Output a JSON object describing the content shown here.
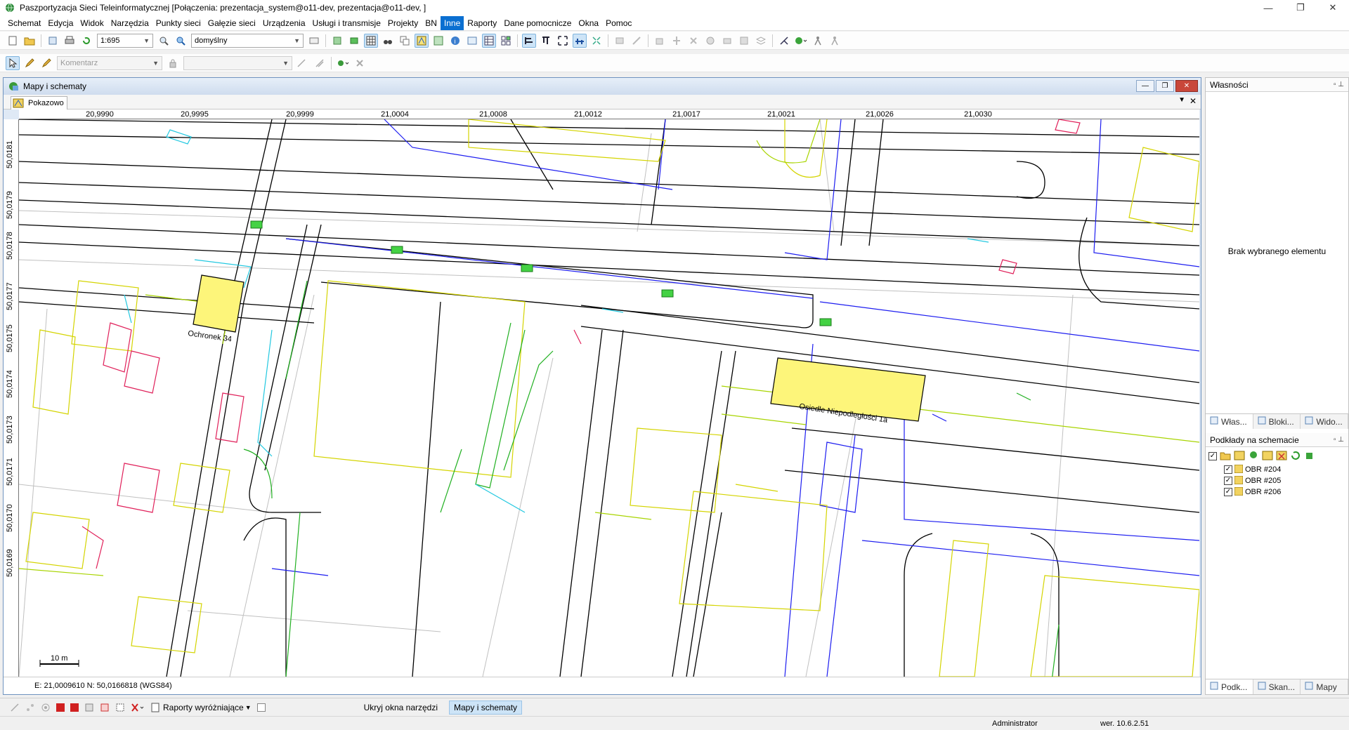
{
  "window": {
    "title": "Paszportyzacja Sieci Teleinformatycznej [Połączenia: prezentacja_system@o11-dev, prezentacja@o11-dev, ]",
    "minimize": "—",
    "restore": "❐",
    "close": "✕"
  },
  "menu": {
    "items": [
      "Schemat",
      "Edycja",
      "Widok",
      "Narzędzia",
      "Punkty sieci",
      "Gałęzie sieci",
      "Urządzenia",
      "Usługi i transmisje",
      "Projekty",
      "BN",
      "Inne",
      "Raporty",
      "Dane pomocnicze",
      "Okna",
      "Pomoc"
    ],
    "active_index": 10
  },
  "toolbar1": {
    "scale_value": "1:695",
    "style_value": "domyślny"
  },
  "toolbar2": {
    "comment_placeholder": "Komentarz"
  },
  "mdi": {
    "title": "Mapy i schematy",
    "tab_label": "Pokazowo"
  },
  "ruler": {
    "x_labels": [
      "20,9990",
      "20,9995",
      "20,9999",
      "21,0004",
      "21,0008",
      "21,0012",
      "21,0017",
      "21,0021",
      "21,0026",
      "21,0030"
    ],
    "y_labels": [
      "50,0181",
      "50,0179",
      "50,0178",
      "50,0177",
      "50,0175",
      "50,0174",
      "50,0173",
      "50,0171",
      "50,0170",
      "50,0169"
    ]
  },
  "map": {
    "street_label_1": "Ochronek 34",
    "street_label_2": "Osiedle Niepodległości 1a",
    "scale_bar_label": "10 m",
    "colors": {
      "building_fill": "#fdf57a",
      "line_black": "#000000",
      "line_blue": "#1d1df0",
      "line_yellow": "#d8d800",
      "line_green": "#20c020",
      "line_cyan": "#23c8e0",
      "line_pink": "#e0205a",
      "line_olive": "#a0d000",
      "node_green": "#44d244"
    }
  },
  "coords": "E: 21,0009610  N: 50,0166818 (WGS84)",
  "properties_panel": {
    "title": "Własności",
    "empty_text": "Brak wybranego elementu",
    "tabs": [
      "Włas...",
      "Bloki...",
      "Wido..."
    ]
  },
  "layers_panel": {
    "title": "Podkłady na schemacie",
    "items": [
      "OBR #204",
      "OBR #205",
      "OBR #206"
    ],
    "tabs": [
      "Podk...",
      "Skan...",
      "Mapy"
    ]
  },
  "bottom_toolbar": {
    "reports_label": "Raporty wyróżniające",
    "hide_tools_label": "Ukryj okna narzędzi",
    "maps_button_label": "Mapy i schematy"
  },
  "status": {
    "user": "Administrator",
    "version": "wer. 10.6.2.51"
  }
}
